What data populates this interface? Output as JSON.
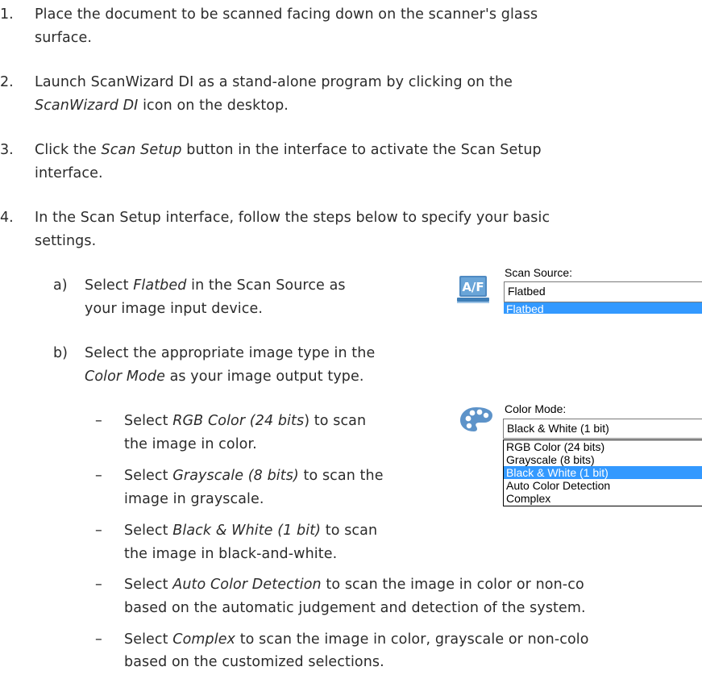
{
  "steps": [
    {
      "number": "1.",
      "lines": [
        "Place the document to be scanned facing down on the scanner's glass",
        "surface."
      ]
    },
    {
      "number": "2.",
      "line1": "Launch ScanWizard DI as a stand-alone program by clicking on the",
      "line2_italic": "ScanWizard DI",
      "line2_rest": " icon on the desktop."
    },
    {
      "number": "3.",
      "line1_pre": "Click the ",
      "line1_italic": "Scan Setup",
      "line1_post": " button in the interface to activate the Scan Setup",
      "line2": "interface."
    },
    {
      "number": "4.",
      "lines": [
        "In the Scan Setup interface, follow the steps below to specify your basic",
        "settings."
      ]
    }
  ],
  "substeps": {
    "a": {
      "marker": "a)",
      "pre": "Select ",
      "italic": "Flatbed",
      "post": " in the Scan Source as",
      "line2": "your image input device."
    },
    "b": {
      "marker": "b)",
      "line1": "Select the appropriate image type in the",
      "italic": "Color Mode",
      "post": " as your image output type."
    }
  },
  "bullets": [
    {
      "dash": "–",
      "pre": "Select ",
      "italic": "RGB Color (24 bits",
      "post": ") to scan",
      "line2": "the image in color."
    },
    {
      "dash": "–",
      "pre": "Select ",
      "italic": "Grayscale (8 bits)",
      "post": " to scan the",
      "line2": "image in grayscale."
    },
    {
      "dash": "–",
      "pre": "Select ",
      "italic": "Black & White (1 bit)",
      "post": " to scan",
      "line2": "the image in black-and-white."
    },
    {
      "dash": "–",
      "pre": "Select ",
      "italic": "Auto Color Detection",
      "post": " to scan the image in color or non-co",
      "line2": "based on the automatic judgement and detection of the system."
    },
    {
      "dash": "–",
      "pre": "Select ",
      "italic": "Complex",
      "post": " to scan the image in color, grayscale or non-colo",
      "line2": "based on the customized selections."
    }
  ],
  "scan_source_widget": {
    "icon": "af-flatbed-icon",
    "label": "Scan Source:",
    "selected": "Flatbed",
    "options": [
      "Flatbed"
    ]
  },
  "color_mode_widget": {
    "icon": "palette-icon",
    "label": "Color Mode:",
    "selected": "Black & White (1 bit)",
    "options": [
      "RGB Color (24 bits)",
      "Grayscale (8 bits)",
      "Black & White (1 bit)",
      "Auto Color Detection",
      "Complex"
    ],
    "highlighted_index": 2
  },
  "colors": {
    "text": "#2b2b2b",
    "highlight": "#3399ff",
    "icon_blue": "#3f7fb8"
  }
}
